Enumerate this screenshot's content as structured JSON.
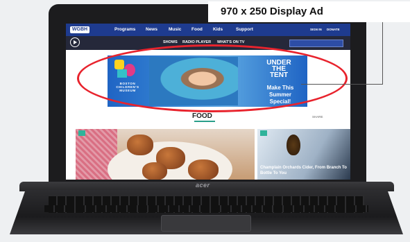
{
  "callout": {
    "label": "970 x 250 Display Ad"
  },
  "laptop": {
    "brand": "acer"
  },
  "site": {
    "logo": "WGBH",
    "nav": [
      "Programs",
      "News",
      "Music",
      "Food",
      "Kids",
      "Support"
    ],
    "nav_right": [
      "SIGN IN",
      "DONATE"
    ],
    "subnav": [
      "SHOWS",
      "RADIO PLAYER",
      "WHAT'S ON TV"
    ]
  },
  "ad": {
    "brand_small": "BOSTON CHILDREN'S MUSEUM",
    "headline": "UNDER THE TENT",
    "cta": "Make This Summer Special!"
  },
  "section": {
    "title": "FOOD",
    "share": "SHARE"
  },
  "cards": [
    {
      "title": ""
    },
    {
      "title": "Champlain Orchards Cider, From Branch To Bottle To You"
    }
  ],
  "colors": {
    "nav": "#1e3b8f",
    "highlight": "#e8232d",
    "accent": "#2a9f8a"
  }
}
